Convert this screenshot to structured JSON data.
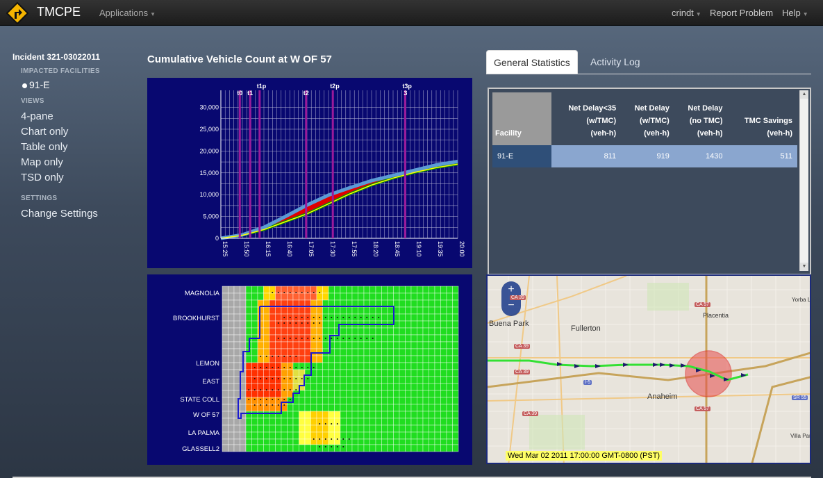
{
  "navbar": {
    "brand": "TMCPE",
    "applications": "Applications",
    "user": "crindt",
    "report": "Report Problem",
    "help": "Help"
  },
  "sidebar": {
    "incident": "Incident 321-03022011",
    "impacted_heading": "IMPACTED FACILITIES",
    "facility": "91-E",
    "views_heading": "VIEWS",
    "views": [
      "4-pane",
      "Chart only",
      "Table only",
      "Map only",
      "TSD only"
    ],
    "settings_heading": "SETTINGS",
    "change_settings": "Change Settings"
  },
  "chart": {
    "title": "Cumulative Vehicle Count at W OF 57",
    "y_ticks": [
      "30,000",
      "25,000",
      "20,000",
      "15,000",
      "10,000",
      "5,000",
      "0"
    ],
    "x_ticks": [
      "15:25",
      "15:50",
      "16:15",
      "16:40",
      "17:05",
      "17:30",
      "17:55",
      "18:20",
      "18:45",
      "19:10",
      "19:35",
      "20:00"
    ],
    "markers": [
      "t0",
      "t1",
      "t1p",
      "t2",
      "t2p",
      "t3p",
      "t3"
    ]
  },
  "chart_data": {
    "type": "area",
    "title": "Cumulative Vehicle Count at W OF 57",
    "x": [
      "15:25",
      "15:50",
      "16:15",
      "16:40",
      "17:05",
      "17:30",
      "17:55",
      "18:20",
      "18:45",
      "19:10",
      "19:35",
      "20:00"
    ],
    "ylim": [
      0,
      32000
    ],
    "series": [
      {
        "values": [
          0,
          800,
          2500,
          5000,
          7600,
          9900,
          11600,
          13200,
          14400,
          15600,
          16800,
          17600
        ]
      },
      {
        "values": [
          0,
          700,
          2000,
          3800,
          5600,
          7900,
          10200,
          12200,
          13800,
          15100,
          16200,
          17000
        ]
      }
    ],
    "markers": [
      {
        "label": "t0",
        "x": "15:47"
      },
      {
        "label": "t1",
        "x": "15:59"
      },
      {
        "label": "t1p",
        "x": "16:10"
      },
      {
        "label": "t2",
        "x": "17:04"
      },
      {
        "label": "t2p",
        "x": "17:35"
      },
      {
        "label": "t3p",
        "x": "18:59"
      },
      {
        "label": "t3",
        "x": "18:59"
      }
    ],
    "grid": true
  },
  "tsd": {
    "labels": [
      "MAGNOLIA",
      "BROOKHURST",
      "LEMON",
      "EAST",
      "STATE COLL",
      "W OF 57",
      "LA PALMA",
      "GLASSELL2"
    ]
  },
  "tabs": [
    "General Statistics",
    "Activity Log"
  ],
  "stats": {
    "headers": [
      {
        "l1": "",
        "l2": "",
        "l3": "Facility"
      },
      {
        "l1": "Net Delay<35",
        "l2": "(w/TMC)",
        "l3": "(veh-h)"
      },
      {
        "l1": "Net Delay",
        "l2": "(w/TMC)",
        "l3": "(veh-h)"
      },
      {
        "l1": "Net Delay",
        "l2": "(no TMC)",
        "l3": "(veh-h)"
      },
      {
        "l1": "TMC Savings",
        "l2": "",
        "l3": "(veh-h)"
      }
    ],
    "row": [
      "91-E",
      "811",
      "919",
      "1430",
      "511"
    ]
  },
  "map": {
    "time": "Wed Mar 02 2011 17:00:00 GMT-0800 (PST)",
    "places": [
      "Buena Park",
      "Fullerton",
      "Placentia",
      "Anaheim",
      "Yorba Linda",
      "Villa Park"
    ],
    "shields": [
      "CA 39",
      "CA 57",
      "I-5",
      "SR 55",
      "CA 91"
    ]
  }
}
